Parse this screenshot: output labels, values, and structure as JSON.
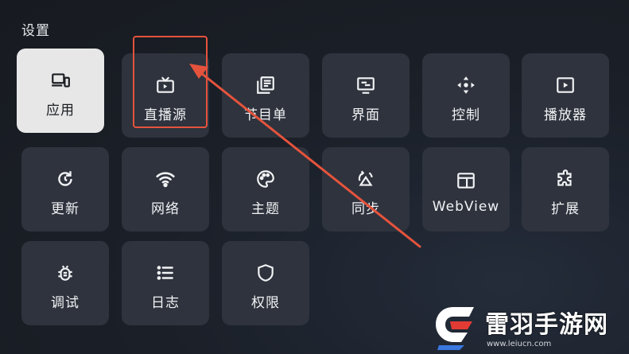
{
  "page_title": "设置",
  "tiles": [
    {
      "label": "应用",
      "icon": "devices-icon"
    },
    {
      "label": "直播源",
      "icon": "live-tv-icon"
    },
    {
      "label": "节目单",
      "icon": "program-list-icon"
    },
    {
      "label": "界面",
      "icon": "interface-icon"
    },
    {
      "label": "控制",
      "icon": "control-dpad-icon"
    },
    {
      "label": "播放器",
      "icon": "player-icon"
    },
    {
      "label": "更新",
      "icon": "update-icon"
    },
    {
      "label": "网络",
      "icon": "wifi-icon"
    },
    {
      "label": "主题",
      "icon": "palette-icon"
    },
    {
      "label": "同步",
      "icon": "sync-icon"
    },
    {
      "label": "WebView",
      "icon": "webview-icon"
    },
    {
      "label": "扩展",
      "icon": "extension-icon"
    },
    {
      "label": "调试",
      "icon": "bug-icon"
    },
    {
      "label": "日志",
      "icon": "log-list-icon"
    },
    {
      "label": "权限",
      "icon": "shield-icon"
    }
  ],
  "selected_tile": "应用",
  "annotation_color": "#e5533d",
  "watermark": {
    "name": "雷羽手游网",
    "url": "www.leiucn.com"
  }
}
